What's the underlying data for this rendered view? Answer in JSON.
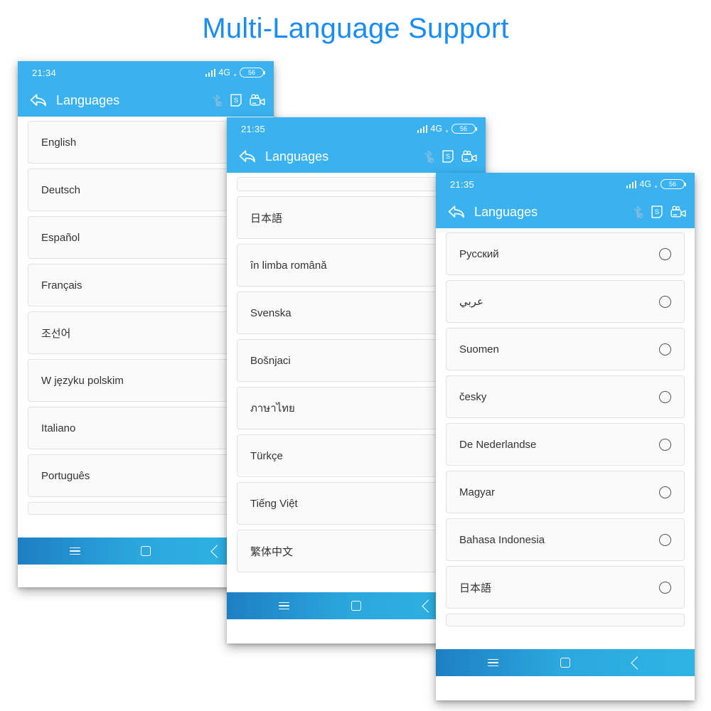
{
  "page": {
    "title": "Multi-Language Support",
    "title_color": "#1a8cf5",
    "background": "#ffffff"
  },
  "common": {
    "appbar_title": "Languages",
    "network_label": "4G",
    "battery_level": "56",
    "accent_color": "#3bb2f0",
    "navbar": {
      "menu_label": "menu",
      "home_label": "home",
      "back_label": "back"
    },
    "appbar_icon_names": [
      "bluetooth-off-icon",
      "sd-card-icon",
      "camcorder-icon"
    ]
  },
  "phones": [
    {
      "id": "phone-1",
      "status_time": "21:34",
      "network_label": "4G",
      "battery_level": "56",
      "appbar_title": "Languages",
      "has_radio": false,
      "items": [
        {
          "label": "English"
        },
        {
          "label": "Deutsch"
        },
        {
          "label": "Español"
        },
        {
          "label": "Français"
        },
        {
          "label": "조선어"
        },
        {
          "label": "W języku polskim"
        },
        {
          "label": "Italiano"
        },
        {
          "label": "Português"
        }
      ]
    },
    {
      "id": "phone-2",
      "status_time": "21:35",
      "network_label": "4G",
      "battery_level": "56",
      "appbar_title": "Languages",
      "has_radio": false,
      "items": [
        {
          "label": "日本語"
        },
        {
          "label": "în limba română"
        },
        {
          "label": "Svenska"
        },
        {
          "label": "Bošnjaci"
        },
        {
          "label": "ภาษาไทย"
        },
        {
          "label": "Türkçe"
        },
        {
          "label": "Tiếng Việt"
        },
        {
          "label": "繁体中文"
        }
      ]
    },
    {
      "id": "phone-3",
      "status_time": "21:35",
      "network_label": "4G",
      "battery_level": "56",
      "appbar_title": "Languages",
      "has_radio": true,
      "items": [
        {
          "label": "Русский"
        },
        {
          "label": "عربي"
        },
        {
          "label": "Suomen"
        },
        {
          "label": "česky"
        },
        {
          "label": "De Nederlandse"
        },
        {
          "label": "Magyar"
        },
        {
          "label": "Bahasa Indonesia"
        },
        {
          "label": "日本語"
        }
      ]
    }
  ]
}
